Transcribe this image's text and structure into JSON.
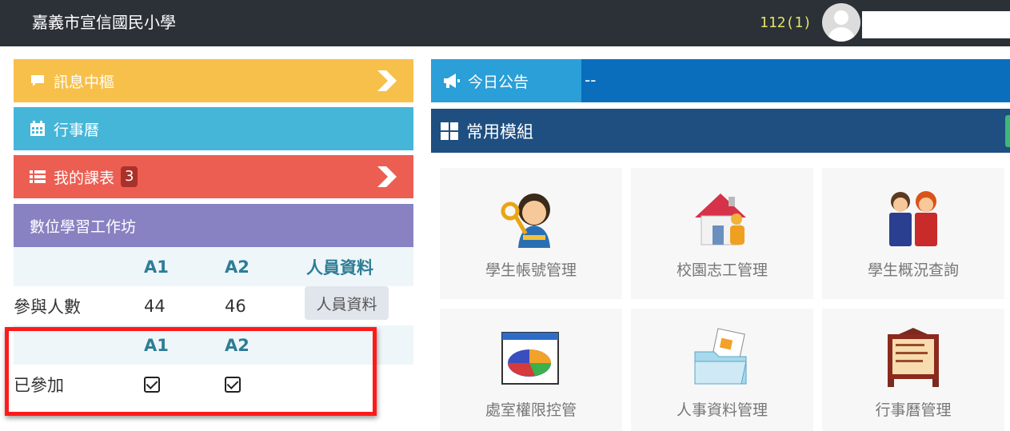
{
  "header": {
    "school_name": "嘉義市宣信國民小學",
    "term": "112(1)",
    "avatar_icon": "user-avatar-icon"
  },
  "left": {
    "messages": {
      "label": "訊息中樞",
      "icon": "comment-icon"
    },
    "calendar": {
      "label": "行事曆",
      "icon": "calendar-icon"
    },
    "schedule": {
      "label": "我的課表",
      "badge": "3",
      "icon": "list-icon"
    },
    "workshop": {
      "title": "數位學習工作坊",
      "header1": {
        "c1": "A1",
        "c2": "A2",
        "c3": "人員資料"
      },
      "participants": {
        "label": "參與人數",
        "a1": "44",
        "a2": "46",
        "button": "人員資料"
      },
      "header2": {
        "c1": "A1",
        "c2": "A2"
      },
      "joined": {
        "label": "已參加",
        "a1_checked": true,
        "a2_checked": true
      }
    }
  },
  "right": {
    "announcement": {
      "label": "今日公告",
      "text": "--",
      "icon": "megaphone-icon"
    },
    "modules": {
      "title": "常用模組",
      "icon": "grid-icon",
      "tiles": [
        {
          "label": "學生帳號管理",
          "icon": "student-key-icon"
        },
        {
          "label": "校園志工管理",
          "icon": "volunteer-house-icon"
        },
        {
          "label": "學生概況查詢",
          "icon": "students-icon"
        },
        {
          "label": "處室權限控管",
          "icon": "pie-chart-window-icon"
        },
        {
          "label": "人事資料管理",
          "icon": "folder-documents-icon"
        },
        {
          "label": "行事曆管理",
          "icon": "calendar-board-icon"
        }
      ]
    }
  },
  "colors": {
    "topbar": "#2b3137",
    "messages": "#f7c04a",
    "calendar": "#45b5d8",
    "schedule": "#ec5e52",
    "workshop": "#8882c2",
    "announcement": "#0a6ebd",
    "modules": "#1e4f80",
    "highlight": "#ff1a1a"
  }
}
